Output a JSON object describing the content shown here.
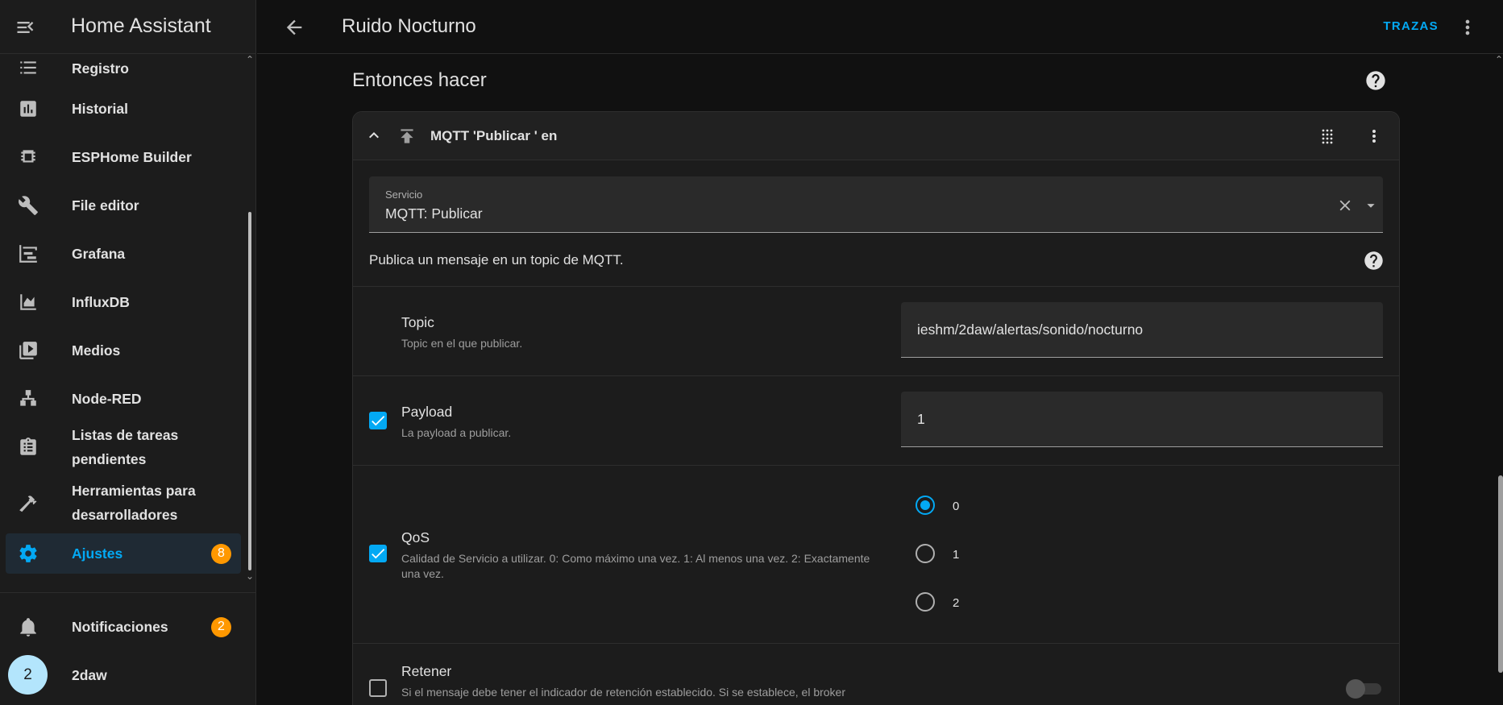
{
  "app": {
    "title": "Home Assistant"
  },
  "sidebar": {
    "items": [
      {
        "label": "Registro",
        "icon": "list-icon"
      },
      {
        "label": "Historial",
        "icon": "chart-box-icon"
      },
      {
        "label": "ESPHome Builder",
        "icon": "chip-icon"
      },
      {
        "label": "File editor",
        "icon": "wrench-icon"
      },
      {
        "label": "Grafana",
        "icon": "chart-timeline-icon"
      },
      {
        "label": "InfluxDB",
        "icon": "chart-areaspline-icon"
      },
      {
        "label": "Medios",
        "icon": "play-box-multiple-icon"
      },
      {
        "label": "Node-RED",
        "icon": "sitemap-icon"
      },
      {
        "label": "Listas de tareas pendientes",
        "icon": "clipboard-list-icon"
      },
      {
        "label_line1": "Herramientas para",
        "label_line2": "desarrolladores",
        "icon": "hammer-icon"
      },
      {
        "label": "Ajustes",
        "icon": "cog-icon",
        "badge": "8",
        "active": true
      }
    ],
    "notifications": {
      "label": "Notificaciones",
      "badge": "2",
      "icon": "bell-icon"
    },
    "user": {
      "label": "2daw",
      "avatar_text": "2"
    }
  },
  "topbar": {
    "title": "Ruido Nocturno",
    "traces_label": "TRAZAS"
  },
  "section": {
    "title": "Entonces hacer"
  },
  "action": {
    "title": "MQTT 'Publicar ' en",
    "service_label": "Servicio",
    "service_value": "MQTT: Publicar",
    "description": "Publica un mensaje en un topic de MQTT.",
    "fields": {
      "topic": {
        "name": "Topic",
        "description": "Topic en el que publicar.",
        "value": "ieshm/2daw/alertas/sonido/nocturno"
      },
      "payload": {
        "name": "Payload",
        "description": "La payload a publicar.",
        "value": "1",
        "enabled": true
      },
      "qos": {
        "name": "QoS",
        "description": "Calidad de Servicio a utilizar. 0: Como máximo una vez. 1: Al menos una vez. 2: Exactamente una vez.",
        "enabled": true,
        "options": [
          "0",
          "1",
          "2"
        ],
        "selected": "0"
      },
      "retain": {
        "name": "Retener",
        "description": "Si el mensaje debe tener el indicador de retención establecido. Si se establece, el broker",
        "enabled": false,
        "toggle_on": false
      }
    }
  },
  "colors": {
    "accent": "#03a9f4",
    "badge": "#ff9800",
    "background": "#111111",
    "card": "#1c1c1c"
  }
}
